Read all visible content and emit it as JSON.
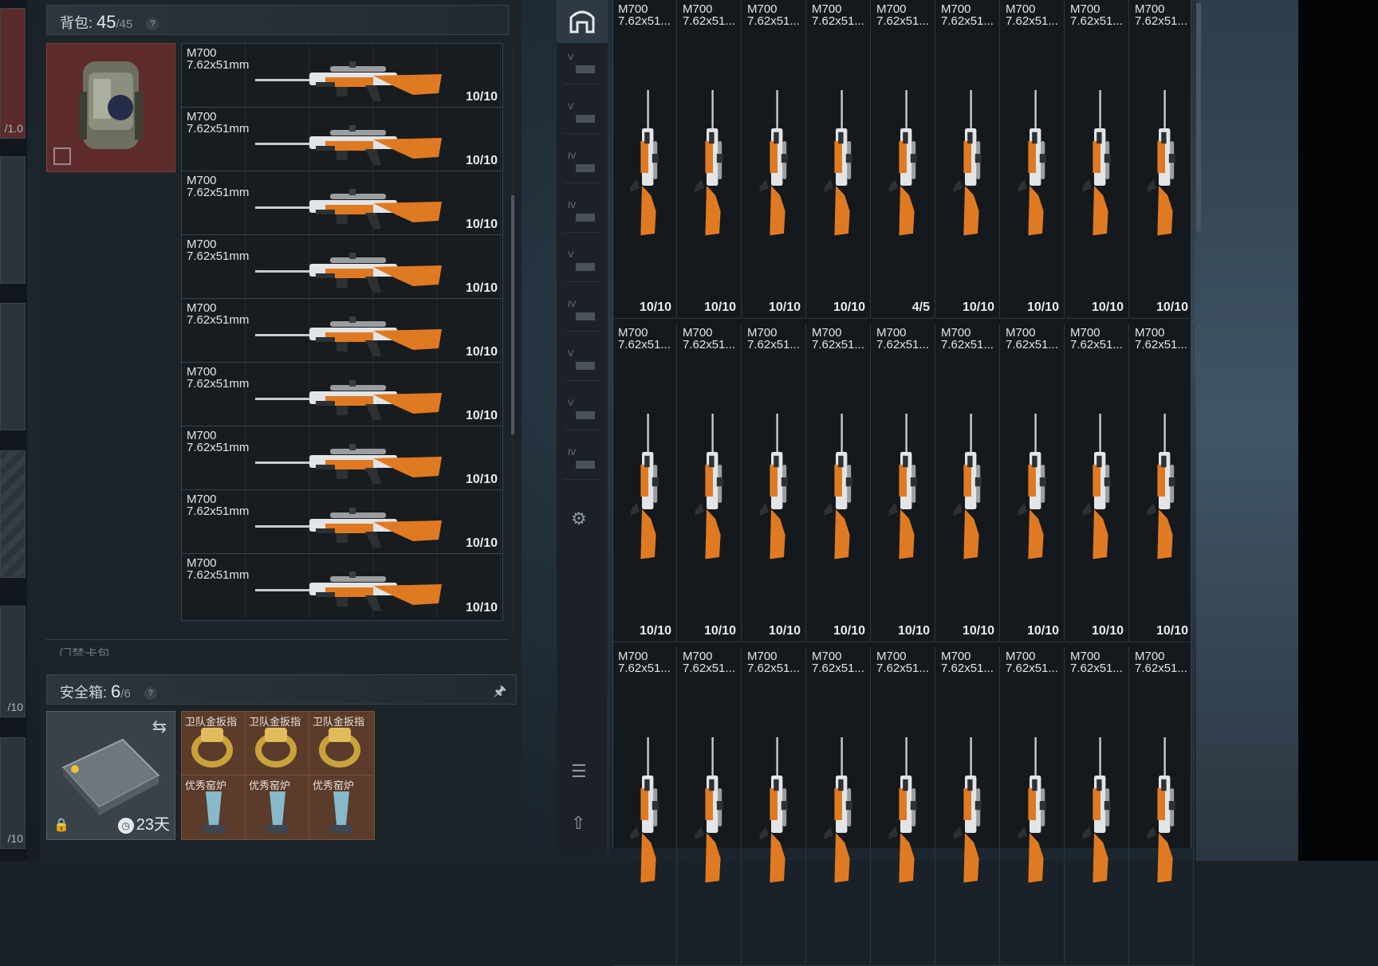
{
  "backpack": {
    "title": "背包:",
    "count": "45",
    "capacity": "/45",
    "help": "?",
    "items": [
      {
        "name": "M700\n7.62x51mm",
        "ammo": "10/10"
      },
      {
        "name": "M700\n7.62x51mm",
        "ammo": "10/10"
      },
      {
        "name": "M700\n7.62x51mm",
        "ammo": "10/10"
      },
      {
        "name": "M700\n7.62x51mm",
        "ammo": "10/10"
      },
      {
        "name": "M700\n7.62x51mm",
        "ammo": "10/10"
      },
      {
        "name": "M700\n7.62x51mm",
        "ammo": "10/10"
      },
      {
        "name": "M700\n7.62x51mm",
        "ammo": "10/10"
      },
      {
        "name": "M700\n7.62x51mm",
        "ammo": "10/10"
      },
      {
        "name": "M700\n7.62x51mm",
        "ammo": "10/10"
      }
    ]
  },
  "card_pack": {
    "label": "门禁卡包"
  },
  "safe_box": {
    "title": "安全箱:",
    "count": "6",
    "capacity": "/6",
    "help": "?",
    "days": "23天",
    "items": [
      {
        "name": "卫队金扳指"
      },
      {
        "name": "卫队金扳指"
      },
      {
        "name": "卫队金扳指"
      },
      {
        "name": "优秀窑炉"
      },
      {
        "name": "优秀窑炉"
      },
      {
        "name": "优秀窑炉"
      }
    ]
  },
  "left_slots": {
    "slot1": "/1.0",
    "slot2": "/10",
    "slot3": "/10"
  },
  "nav": {
    "levels": [
      "V",
      "V",
      "IV",
      "IV",
      "V",
      "IV",
      "V",
      "V",
      "IV"
    ]
  },
  "inventory": {
    "rows": [
      {
        "items": [
          {
            "name": "M700\n7.62x51...",
            "ammo": "10/10"
          },
          {
            "name": "M700\n7.62x51...",
            "ammo": "10/10"
          },
          {
            "name": "M700\n7.62x51...",
            "ammo": "10/10"
          },
          {
            "name": "M700\n7.62x51...",
            "ammo": "10/10"
          },
          {
            "name": "M700\n7.62x51...",
            "ammo": "4/5"
          },
          {
            "name": "M700\n7.62x51...",
            "ammo": "10/10"
          },
          {
            "name": "M700\n7.62x51...",
            "ammo": "10/10"
          },
          {
            "name": "M700\n7.62x51...",
            "ammo": "10/10"
          },
          {
            "name": "M700\n7.62x51...",
            "ammo": "10/10"
          }
        ]
      },
      {
        "items": [
          {
            "name": "M700\n7.62x51...",
            "ammo": "10/10"
          },
          {
            "name": "M700\n7.62x51...",
            "ammo": "10/10"
          },
          {
            "name": "M700\n7.62x51...",
            "ammo": "10/10"
          },
          {
            "name": "M700\n7.62x51...",
            "ammo": "10/10"
          },
          {
            "name": "M700\n7.62x51...",
            "ammo": "10/10"
          },
          {
            "name": "M700\n7.62x51...",
            "ammo": "10/10"
          },
          {
            "name": "M700\n7.62x51...",
            "ammo": "10/10"
          },
          {
            "name": "M700\n7.62x51...",
            "ammo": "10/10"
          },
          {
            "name": "M700\n7.62x51...",
            "ammo": "10/10"
          }
        ]
      },
      {
        "items": [
          {
            "name": "M700\n7.62x51...",
            "ammo": ""
          },
          {
            "name": "M700\n7.62x51...",
            "ammo": ""
          },
          {
            "name": "M700\n7.62x51...",
            "ammo": ""
          },
          {
            "name": "M700\n7.62x51...",
            "ammo": ""
          },
          {
            "name": "M700\n7.62x51...",
            "ammo": ""
          },
          {
            "name": "M700\n7.62x51...",
            "ammo": ""
          },
          {
            "name": "M700\n7.62x51...",
            "ammo": ""
          },
          {
            "name": "M700\n7.62x51...",
            "ammo": ""
          },
          {
            "name": "M700\n7.62x51...",
            "ammo": ""
          }
        ]
      }
    ]
  },
  "colors": {
    "accent_orange": "#e07a22",
    "bag_red": "#5e2b2b",
    "safe_brown": "#5b3b2a"
  }
}
